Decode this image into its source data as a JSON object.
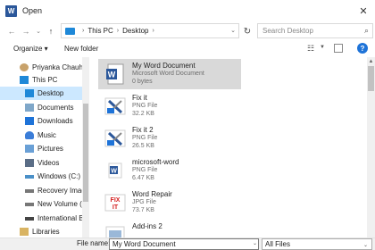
{
  "window": {
    "title": "Open",
    "app_icon_letter": "W",
    "close_glyph": "✕"
  },
  "nav": {
    "back_glyph": "←",
    "forward_glyph": "→",
    "recent_glyph": "⌄",
    "up_glyph": "↑",
    "breadcrumb": [
      "This PC",
      "Desktop"
    ],
    "breadcrumb_sep": "›",
    "dropdown_glyph": "⌄",
    "refresh_glyph": "↻",
    "search_placeholder": "Search Desktop",
    "search_glyph": "⌕"
  },
  "commands": {
    "organize": "Organize ▾",
    "new_folder": "New folder",
    "help_glyph": "?"
  },
  "sidebar": {
    "items": [
      {
        "label": "Priyanka Chauha",
        "icon": "user-icon",
        "color": "#c8a26b"
      },
      {
        "label": "This PC",
        "icon": "computer-icon",
        "color": "#1e88d8"
      },
      {
        "label": "Desktop",
        "icon": "desktop-icon",
        "color": "#1e88d8",
        "selected": true
      },
      {
        "label": "Documents",
        "icon": "documents-icon",
        "color": "#7fa7c9"
      },
      {
        "label": "Downloads",
        "icon": "downloads-icon",
        "color": "#1e73d8"
      },
      {
        "label": "Music",
        "icon": "music-icon",
        "color": "#3b7dd8"
      },
      {
        "label": "Pictures",
        "icon": "pictures-icon",
        "color": "#6aa0d6"
      },
      {
        "label": "Videos",
        "icon": "videos-icon",
        "color": "#5a6d86"
      },
      {
        "label": "Windows (C:)",
        "icon": "drive-icon",
        "color": "#4a90c8"
      },
      {
        "label": "Recovery Imag",
        "icon": "drive-icon",
        "color": "#777777"
      },
      {
        "label": "New Volume (E",
        "icon": "drive-icon",
        "color": "#777777"
      },
      {
        "label": "International B",
        "icon": "drive-icon",
        "color": "#444444"
      },
      {
        "label": "Libraries",
        "icon": "libraries-icon",
        "color": "#d9b463"
      }
    ]
  },
  "files": [
    {
      "name": "My Word Document",
      "type": "Microsoft Word Document",
      "size": "0 bytes",
      "icon": "word-document-icon",
      "selected": true
    },
    {
      "name": "Fix it",
      "type": "PNG File",
      "size": "32.2 KB",
      "icon": "fixit-image-icon"
    },
    {
      "name": "Fix it 2",
      "type": "PNG File",
      "size": "26.5 KB",
      "icon": "fixit-image-icon"
    },
    {
      "name": "microsoft-word",
      "type": "PNG File",
      "size": "6.47 KB",
      "icon": "word-image-icon"
    },
    {
      "name": "Word Repair",
      "type": "JPG File",
      "size": "73.7 KB",
      "icon": "repair-image-icon"
    },
    {
      "name": "Add-ins 2",
      "type": "",
      "size": "",
      "icon": "image-icon"
    }
  ],
  "footer": {
    "file_name_label": "File name:",
    "file_name_value": "My Word Document",
    "filter_value": "All Files",
    "dropdown_glyph": "⌄"
  },
  "colors": {
    "selection_sidebar": "#cce8ff",
    "selection_file": "#d9d9d9",
    "accent": "#1e73d8"
  }
}
